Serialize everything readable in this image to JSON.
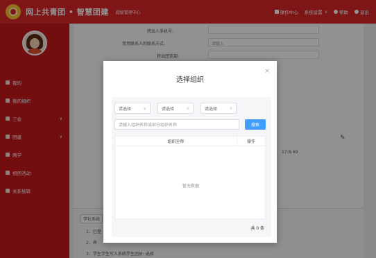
{
  "header": {
    "brand": "网上共青团 • 智慧团建",
    "subsystem": "超级管理中心",
    "nav": [
      {
        "icon": "mail-icon",
        "label": "操作中心"
      },
      {
        "icon": "",
        "label": "系统设置"
      },
      {
        "icon": "help-icon",
        "label": "帮助"
      },
      {
        "icon": "power-icon",
        "label": "退出"
      }
    ]
  },
  "sidebar": {
    "items": [
      {
        "icon": "home-icon",
        "label": "我的"
      },
      {
        "icon": "users-icon",
        "label": "我的组织"
      },
      {
        "icon": "grid-icon",
        "label": "三会"
      },
      {
        "icon": "folder-icon",
        "label": "团建"
      },
      {
        "icon": "settings-icon",
        "label": "两学"
      },
      {
        "icon": "target-icon",
        "label": "组团活动"
      },
      {
        "icon": "refresh-icon",
        "label": "关系接转"
      }
    ]
  },
  "form": {
    "rows": [
      {
        "label": "转出人手机号:",
        "value": ""
      },
      {
        "label": "常用联系人的联系方式:",
        "value": "请输入"
      },
      {
        "label": "转出团支部:",
        "value": ""
      }
    ],
    "timestamp": "17:8:49"
  },
  "note": {
    "title": "学社系统",
    "lines": [
      "1、已登",
      "2、养",
      "3、学生学生写入系统学生团员: 选择"
    ]
  },
  "modal": {
    "title": "选择组织",
    "close": "×",
    "selects": [
      "请选择",
      "请选择",
      "请选择"
    ],
    "search_placeholder": "请输入组织名称或部分组织名称",
    "search_button": "搜索",
    "columns": [
      "组织全称",
      "操作"
    ],
    "empty_text": "暂无数据",
    "total": "共 0 条"
  }
}
